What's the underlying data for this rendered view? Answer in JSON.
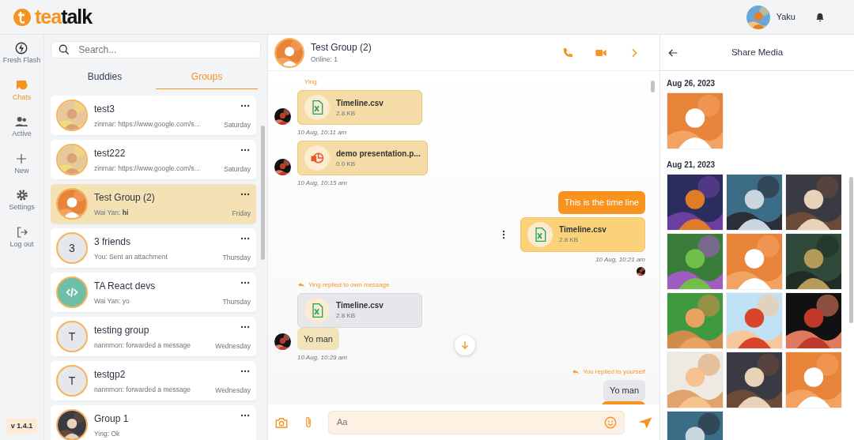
{
  "header": {
    "logo": [
      "tea",
      "talk"
    ],
    "user": "Yaku"
  },
  "nav": [
    {
      "label": "Fresh Flash",
      "selected": false
    },
    {
      "label": "Chats",
      "selected": true
    },
    {
      "label": "Active",
      "selected": false
    },
    {
      "label": "New",
      "selected": false
    },
    {
      "label": "Settings",
      "selected": false
    },
    {
      "label": "Log out",
      "selected": false
    }
  ],
  "version": "v 1.4.1",
  "search": {
    "placeholder": "Search..."
  },
  "tabs": [
    {
      "label": "Buddies",
      "selected": false
    },
    {
      "label": "Groups",
      "selected": true
    }
  ],
  "conversations": [
    {
      "name": "test3",
      "preview": "zinmar: https://www.google.com/s...",
      "day": "Saturday",
      "selected": false
    },
    {
      "name": "test222",
      "preview": "zinmar: https://www.google.com/s...",
      "day": "Saturday",
      "selected": false
    },
    {
      "name": "Test Group (2)",
      "preview": "Wai Yan: **hi**",
      "day": "Friday",
      "selected": true
    },
    {
      "name": "3 friends",
      "preview": "You: Sent an attachment",
      "day": "Thursday",
      "avatar": {
        "kind": "letter",
        "letter": "3"
      },
      "selected": false
    },
    {
      "name": "TA React devs",
      "preview": "Wai Yan: yo",
      "day": "Thursday",
      "avatar": {
        "kind": "code"
      },
      "selected": false
    },
    {
      "name": "testing group",
      "preview": "nannmon: forwarded a message",
      "day": "Wednesday",
      "avatar": {
        "kind": "letter",
        "letter": "T"
      },
      "selected": false
    },
    {
      "name": "testgp2",
      "preview": "nannmon: forwarded a message",
      "day": "Wednesday",
      "avatar": {
        "kind": "letter",
        "letter": "T"
      },
      "selected": false
    },
    {
      "name": "Group 1",
      "preview": "Ying: Ok",
      "selected": false
    }
  ],
  "chat": {
    "title": "Test Group (2)",
    "status": "Online: 1",
    "messages": [
      {
        "outgoing": false,
        "kind": "file",
        "sender": "Ying",
        "file": {
          "kind": "spreadsheet",
          "name": "Timeline.csv",
          "size": "2.8 KB"
        },
        "time": "10 Aug, 10:11 am"
      },
      {
        "outgoing": false,
        "kind": "file",
        "file": {
          "kind": "presentation",
          "name": "demo presentation.p...",
          "size": "0.0 KB"
        },
        "time": "10 Aug, 10:15 am"
      },
      {
        "outgoing": true,
        "kind": "text",
        "text": "This is the time line"
      },
      {
        "outgoing": true,
        "kind": "file",
        "file": {
          "kind": "spreadsheet",
          "name": "Timeline.csv",
          "size": "2.8 KB"
        },
        "time": "10 Aug, 10:21 am",
        "seen": true,
        "menu": true
      },
      {
        "outgoing": false,
        "kind": "reply",
        "reply_label": "Ying replied to own message",
        "quote": {
          "kind": "file",
          "file": {
            "kind": "spreadsheet",
            "name": "Timeline.csv",
            "size": "2.8 KB"
          }
        },
        "text": "Yo man",
        "time": "10 Aug, 10:29 am"
      },
      {
        "outgoing": true,
        "kind": "reply",
        "reply_label": "You replied to yourself",
        "quote": {
          "kind": "text",
          "text": "Yo man"
        }
      }
    ],
    "input": {
      "placeholder": "Aa"
    }
  },
  "media": {
    "title": "Share Media",
    "groups": [
      {
        "date": "Aug 26, 2023"
      },
      {
        "date": "Aug 21, 2023"
      }
    ]
  }
}
